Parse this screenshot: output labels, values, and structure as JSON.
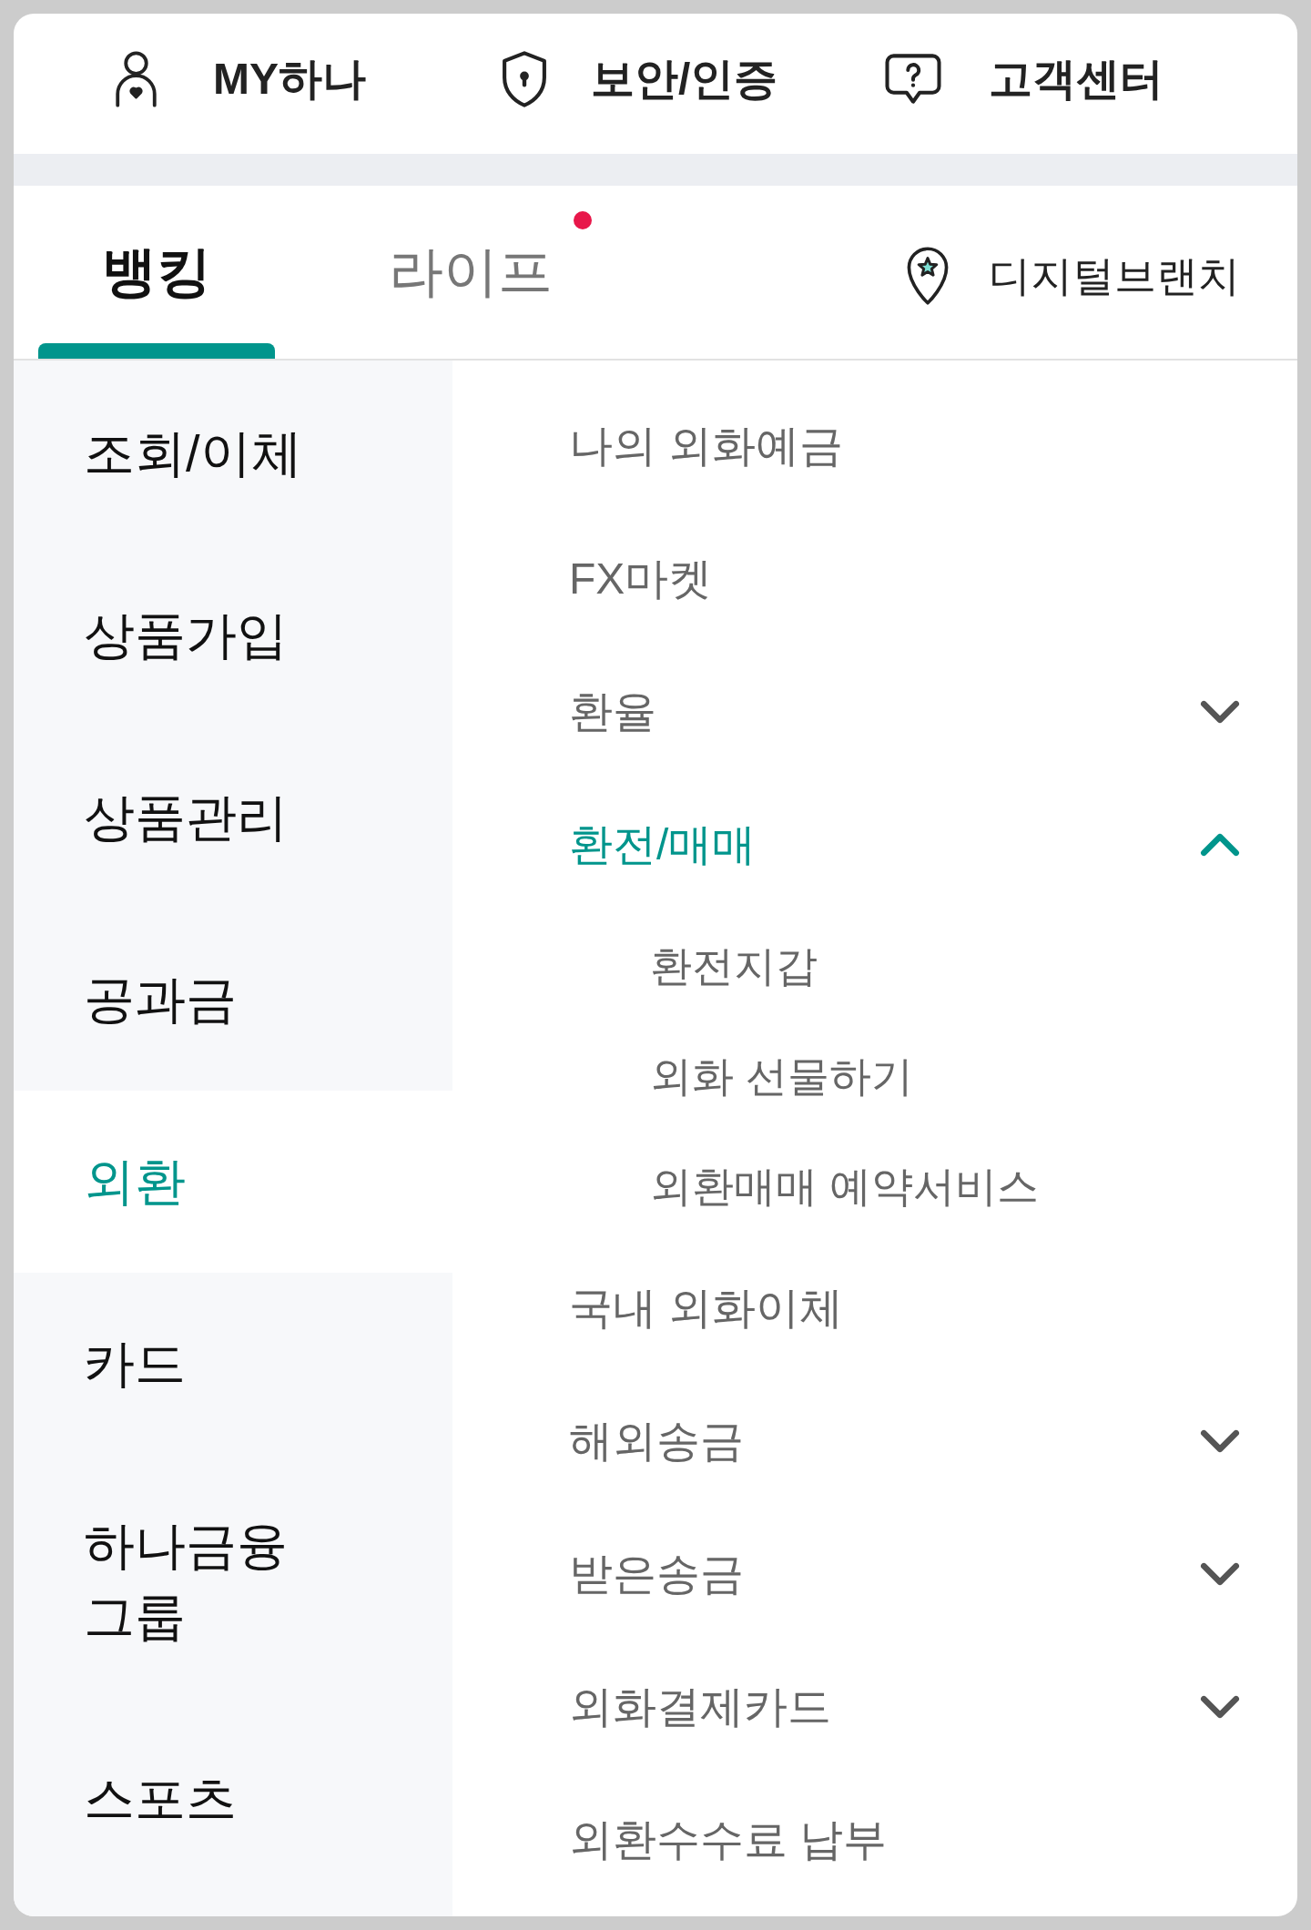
{
  "top_links": [
    {
      "label": "MY하나"
    },
    {
      "label": "보안/인증"
    },
    {
      "label": "고객센터"
    }
  ],
  "tabs": [
    {
      "label": "뱅킹",
      "selected": true,
      "dot": false
    },
    {
      "label": "라이프",
      "selected": false,
      "dot": true
    }
  ],
  "branch_link": {
    "label": "디지털브랜치"
  },
  "sidebar": {
    "items": [
      {
        "label": "조회/이체",
        "selected": false
      },
      {
        "label": "상품가입",
        "selected": false
      },
      {
        "label": "상품관리",
        "selected": false
      },
      {
        "label": "공과금",
        "selected": false
      },
      {
        "label": "외환",
        "selected": true
      },
      {
        "label": "카드",
        "selected": false
      },
      {
        "label": "하나금융 그룹",
        "selected": false
      },
      {
        "label": "스포츠",
        "selected": false
      }
    ]
  },
  "submenu": {
    "items": [
      {
        "kind": "link",
        "label": "나의 외화예금"
      },
      {
        "kind": "link",
        "label": "FX마켓"
      },
      {
        "kind": "group",
        "label": "환율",
        "expanded": false
      },
      {
        "kind": "group",
        "label": "환전/매매",
        "expanded": true,
        "children": [
          {
            "label": "환전지갑"
          },
          {
            "label": "외화 선물하기"
          },
          {
            "label": "외환매매 예약서비스"
          }
        ]
      },
      {
        "kind": "link",
        "label": "국내 외화이체"
      },
      {
        "kind": "group",
        "label": "해외송금",
        "expanded": false
      },
      {
        "kind": "group",
        "label": "받은송금",
        "expanded": false
      },
      {
        "kind": "group",
        "label": "외화결제카드",
        "expanded": false
      },
      {
        "kind": "link",
        "label": "외환수수료 납부"
      }
    ]
  }
}
